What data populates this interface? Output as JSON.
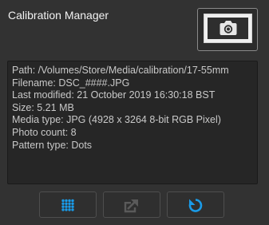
{
  "panel": {
    "title": "Calibration Manager"
  },
  "camera_button": {
    "icon": "camera-icon"
  },
  "info": {
    "lines": [
      "Path: /Volumes/Store/Media/calibration/17-55mm",
      "Filename: DSC_####.JPG",
      "Last modified: 21 October 2019 16:30:18 BST",
      "Size: 5.21 MB",
      "Media type: JPG (4928 x 3264 8-bit RGB Pixel)",
      "Photo count: 8",
      "Pattern type: Dots"
    ]
  },
  "toolbar": {
    "buttons": [
      {
        "name": "dot-grid-button",
        "icon": "dot-grid-icon",
        "enabled": true
      },
      {
        "name": "export-button",
        "icon": "export-icon",
        "enabled": false
      },
      {
        "name": "refresh-button",
        "icon": "refresh-icon",
        "enabled": true
      }
    ]
  },
  "colors": {
    "background": "#323232",
    "accent": "#1a9be8",
    "text": "#c9c9c9"
  }
}
